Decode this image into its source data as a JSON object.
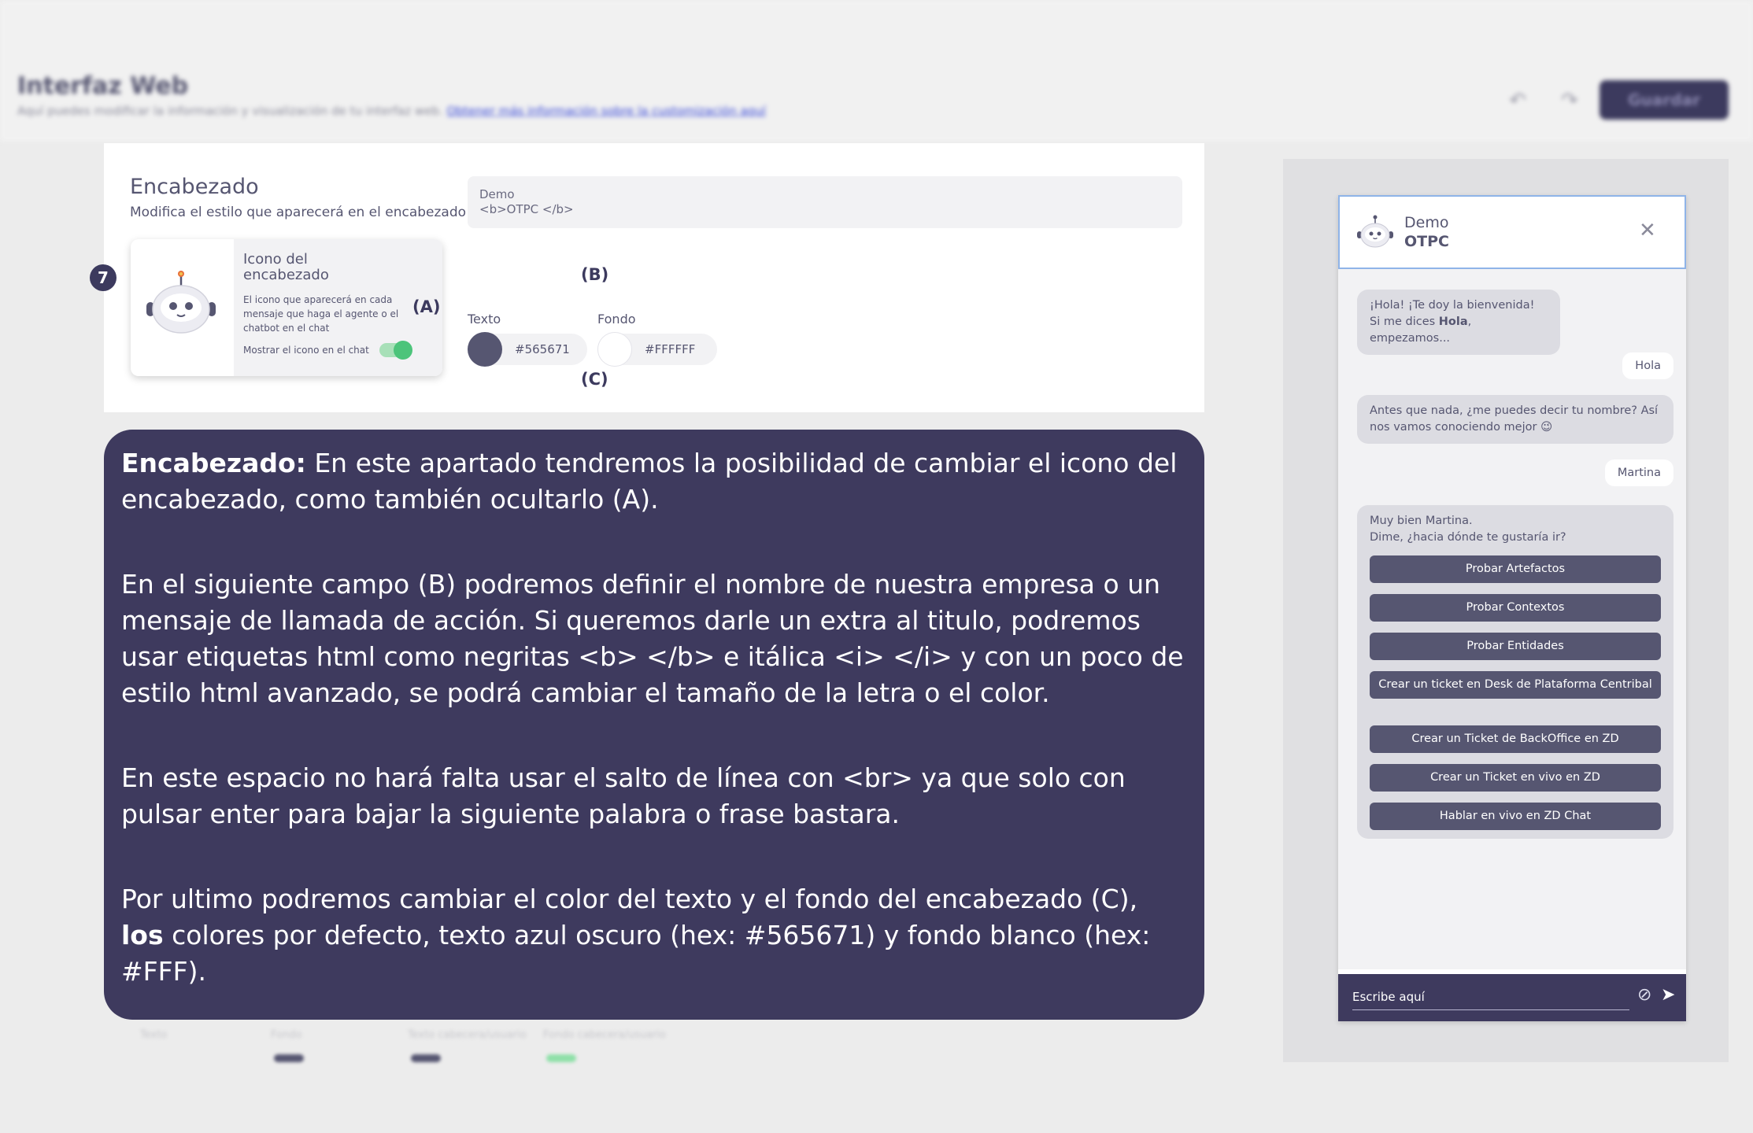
{
  "app": {
    "title": "Interfaz Web",
    "subtitle": "Aquí puedes modificar la información y visualización de tu interfaz web.",
    "subtitle_link": "Obtener más información sobre la customización aquí",
    "undo_icon": "undo-icon",
    "redo_icon": "redo-icon",
    "save_label": "Guardar"
  },
  "card": {
    "title": "Encabezado",
    "subtitle": "Modifica el estilo que aparecerá en el encabezado de tu interfaz web.",
    "step": "7",
    "icon_box": {
      "title": "Icono del encabezado",
      "description": "El icono que aparecerá en cada mensaje que haga el agente o el chatbot en el chat",
      "show_label": "Mostrar el icono en el chat",
      "show_enabled": true,
      "mark": "(A)"
    },
    "title_field": {
      "line1": "Demo",
      "line2": "<b>OTPC </b>",
      "mark": "(B)"
    },
    "text_color": {
      "label": "Texto",
      "value": "#565671"
    },
    "bg_color": {
      "label": "Fondo",
      "value": "#FFFFFF"
    },
    "colors_mark": "(C)"
  },
  "overlay": {
    "p1_bold": "Encabezado:",
    "p1_rest": " En este apartado tendremos la posibilidad de cambiar el icono del encabezado, como también ocultarlo (A).",
    "p2": "En el siguiente campo (B) podremos definir el nombre de nuestra empresa o un mensaje de llamada de acción. Si queremos darle un extra al titulo, podremos usar etiquetas html como negritas <b> </b> e itálica <i> </i> y con un poco de estilo html avanzado, se podrá cambiar el tamaño de la letra o el color.",
    "p3": "En este espacio no hará falta usar el salto de línea con <br> ya que solo con pulsar enter para bajar la siguiente palabra o frase bastara.",
    "p4_start": "Por ultimo podremos cambiar el color del texto y el fondo del encabezado (C), ",
    "p4_bold": "los",
    "p4_rest": " colores por defecto, texto azul oscuro (hex: #565671) y fondo blanco (hex: #FFF)."
  },
  "faded": {
    "labels": [
      "Texto",
      "Fondo",
      "Texto cabecera/usuario",
      "Fondo cabecera/usuario"
    ]
  },
  "chat": {
    "name_line1": "Demo",
    "name_line2": "OTPC",
    "close_icon": "close-icon",
    "messages": {
      "bot1_line1": "¡Hola! ¡Te doy la bienvenida!",
      "bot1_line2_pre": "Si me dices ",
      "bot1_line2_bold": "Hola",
      "bot1_line2_post": ", empezamos...",
      "user1": "Hola",
      "bot2": "Antes que nada, ¿me puedes decir tu nombre? Así nos vamos conociendo mejor 😉",
      "user2": "Martina",
      "bot3_line1": "Muy bien Martina.",
      "bot3_line2": "Dime, ¿hacia dónde te gustaría ir?"
    },
    "options": [
      "Probar Artefactos",
      "Probar Contextos",
      "Probar Entidades",
      "Crear un ticket en Desk de Plataforma Centribal",
      "Crear un Ticket de BackOffice en ZD",
      "Crear un Ticket en vivo en ZD",
      "Hablar en vivo en ZD Chat"
    ],
    "input_placeholder": "Escribe aquí",
    "attach_icon": "paperclip-icon",
    "send_icon": "send-icon"
  }
}
